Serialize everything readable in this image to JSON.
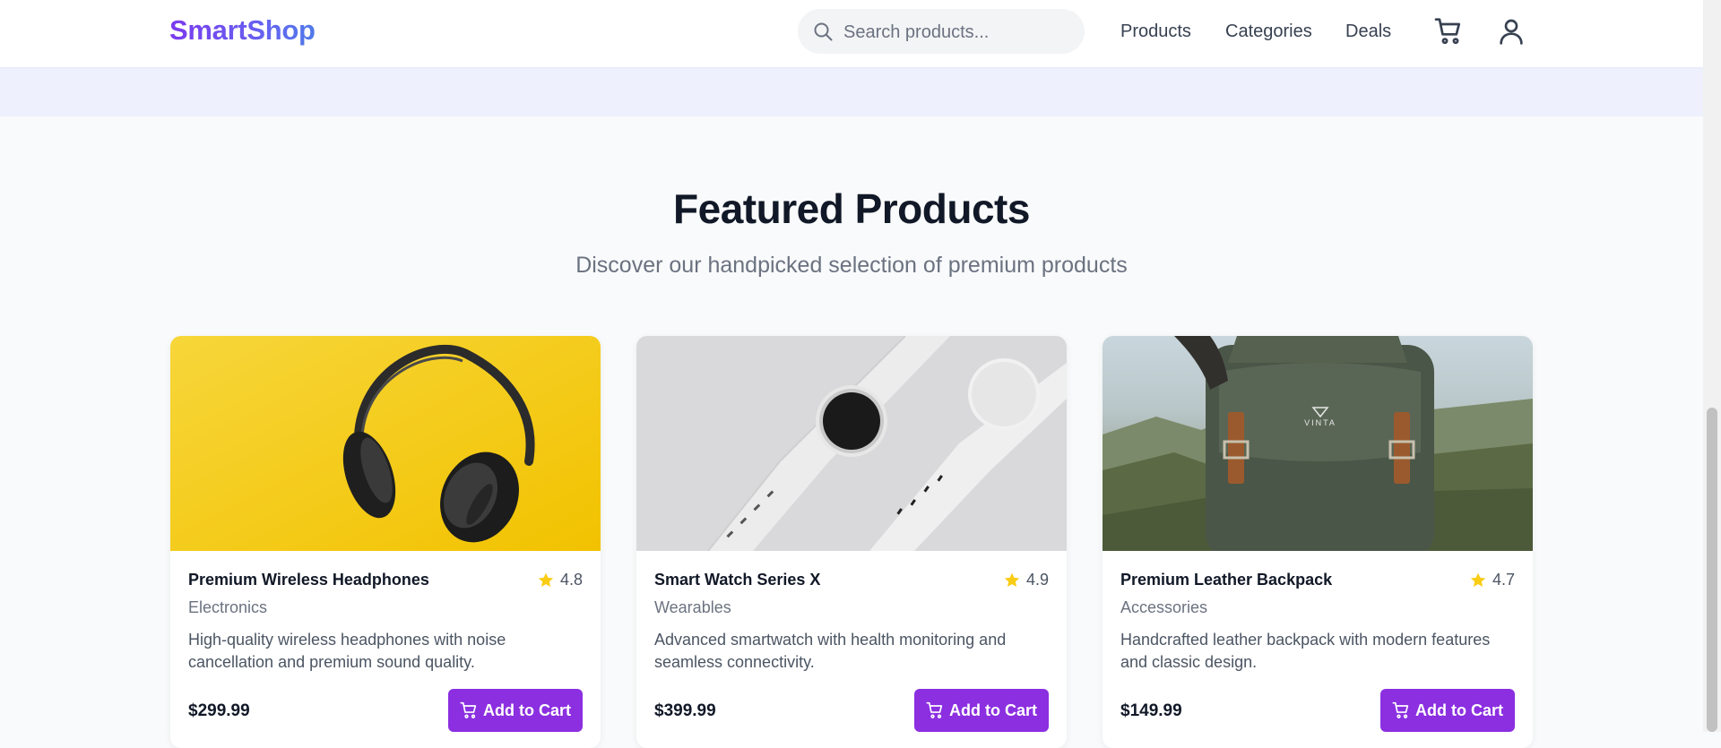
{
  "header": {
    "logo": "SmartShop",
    "search_placeholder": "Search products...",
    "nav": [
      "Products",
      "Categories",
      "Deals"
    ],
    "icons": [
      "search-icon",
      "cart-icon",
      "user-icon"
    ]
  },
  "section": {
    "title": "Featured Products",
    "subtitle": "Discover our handpicked selection of premium products"
  },
  "products": [
    {
      "name": "Premium Wireless Headphones",
      "rating": "4.8",
      "category": "Electronics",
      "description": "High-quality wireless headphones with noise cancellation and premium sound quality.",
      "price": "$299.99",
      "button": "Add to Cart"
    },
    {
      "name": "Smart Watch Series X",
      "rating": "4.9",
      "category": "Wearables",
      "description": "Advanced smartwatch with health monitoring and seamless connectivity.",
      "price": "$399.99",
      "button": "Add to Cart"
    },
    {
      "name": "Premium Leather Backpack",
      "rating": "4.7",
      "category": "Accessories",
      "description": "Handcrafted leather backpack with modern features and classic design.",
      "price": "$149.99",
      "button": "Add to Cart"
    }
  ],
  "backpack_logo": "VINTA",
  "colors": {
    "brand_gradient": [
      "#7c3aed",
      "#4f7be8"
    ],
    "button": "#8b2fe0",
    "star": "#facc15",
    "page_bg": "#f9fafb"
  }
}
